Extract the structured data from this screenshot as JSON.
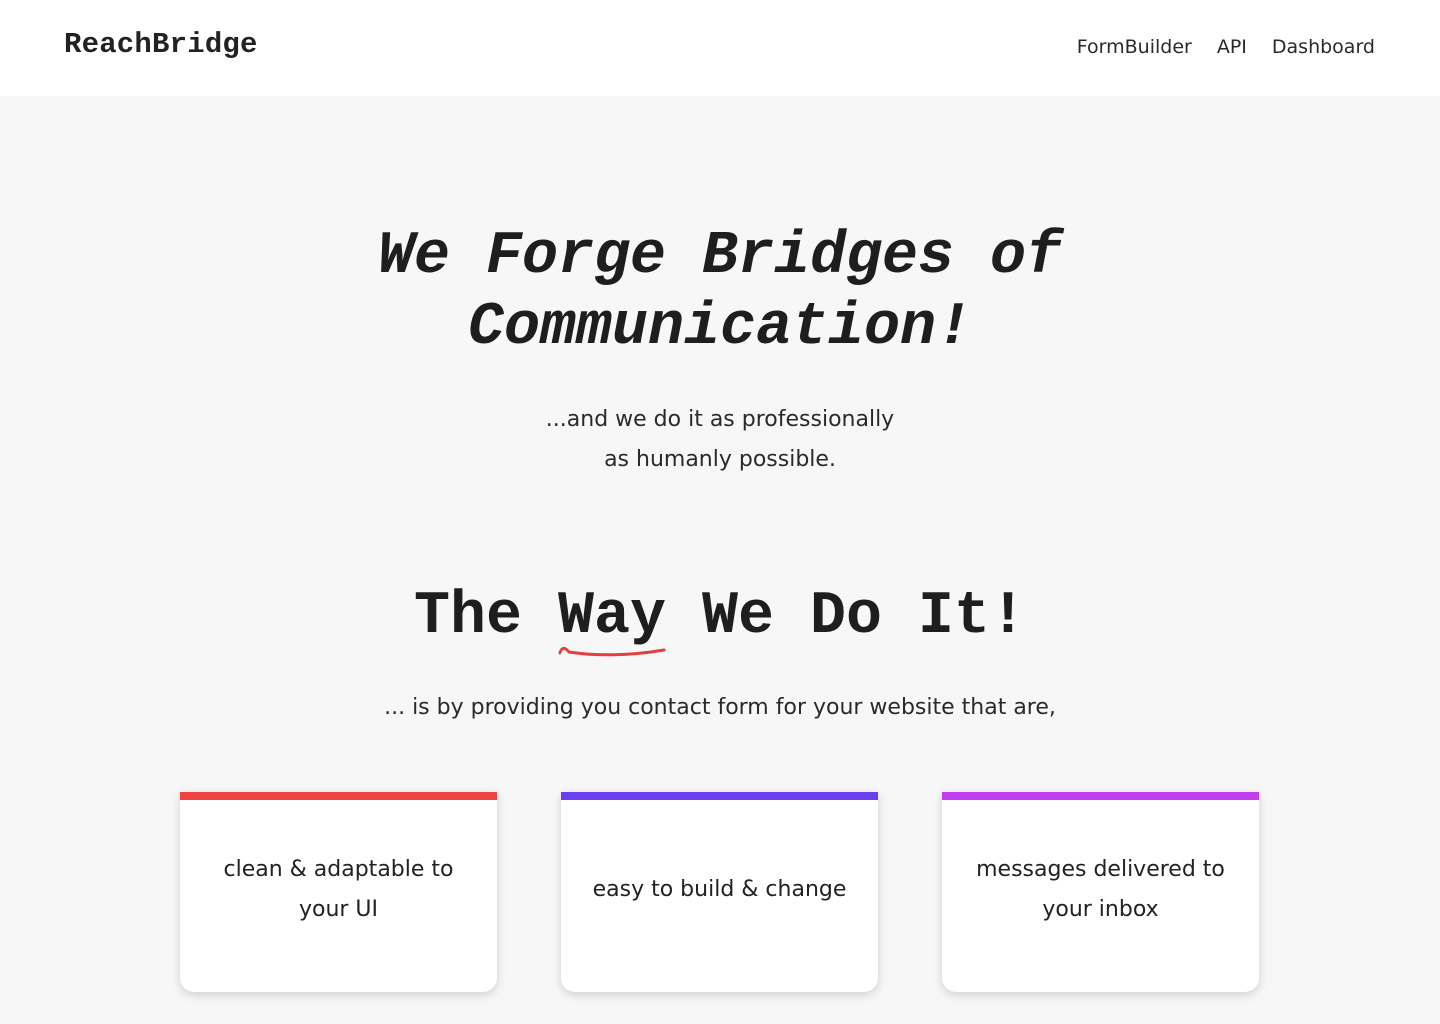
{
  "header": {
    "logo": "ReachBridge",
    "nav": [
      "FormBuilder",
      "API",
      "Dashboard"
    ]
  },
  "hero": {
    "title_lines": [
      "We Forge Bridges of",
      "Communication!"
    ],
    "subtitle_lines": [
      "...and we do it as professionally",
      "as humanly possible."
    ]
  },
  "section": {
    "title_before": "The ",
    "title_highlight": "Way",
    "title_after": " We Do It!",
    "highlight_color": "#e53e3e",
    "subtitle": "... is by providing you contact form for your website that are,"
  },
  "features": [
    {
      "text": "clean & adaptable to your UI",
      "accent": "#ef4444"
    },
    {
      "text": "easy to build & change",
      "accent": "#6d3ef0"
    },
    {
      "text": "messages delivered to your inbox",
      "accent": "#c23cf0"
    }
  ]
}
